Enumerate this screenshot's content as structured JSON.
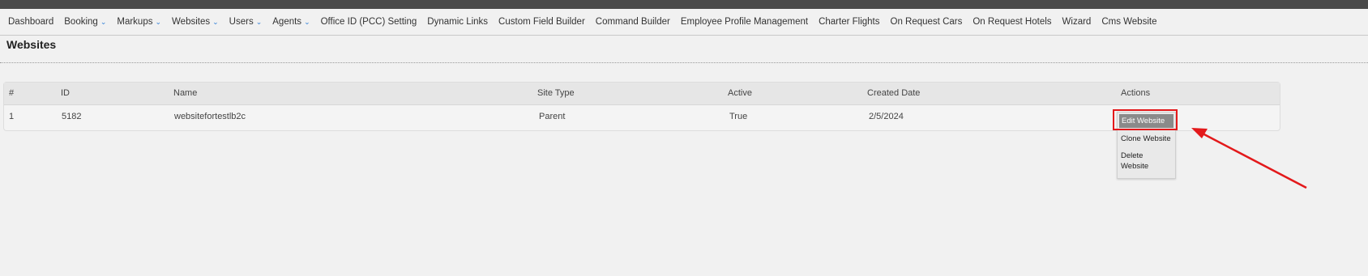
{
  "nav": {
    "items": [
      {
        "label": "Dashboard",
        "dropdown": false
      },
      {
        "label": "Booking",
        "dropdown": true
      },
      {
        "label": "Markups",
        "dropdown": true
      },
      {
        "label": "Websites",
        "dropdown": true
      },
      {
        "label": "Users",
        "dropdown": true
      },
      {
        "label": "Agents",
        "dropdown": true
      },
      {
        "label": "Office ID (PCC) Setting",
        "dropdown": false
      },
      {
        "label": "Dynamic Links",
        "dropdown": false
      },
      {
        "label": "Custom Field Builder",
        "dropdown": false
      },
      {
        "label": "Command Builder",
        "dropdown": false
      },
      {
        "label": "Employee Profile Management",
        "dropdown": false
      },
      {
        "label": "Charter Flights",
        "dropdown": false
      },
      {
        "label": "On Request Cars",
        "dropdown": false
      },
      {
        "label": "On Request Hotels",
        "dropdown": false
      },
      {
        "label": "Wizard",
        "dropdown": false
      },
      {
        "label": "Cms Website",
        "dropdown": false
      }
    ]
  },
  "page": {
    "title": "Websites"
  },
  "table": {
    "headers": [
      "#",
      "ID",
      "Name",
      "Site Type",
      "Active",
      "Created Date",
      "Actions"
    ],
    "rows": [
      [
        "1",
        "5182",
        "websitefortestlb2c",
        "Parent",
        "True",
        "2/5/2024"
      ]
    ]
  },
  "actions_menu": {
    "edit": "Edit Website",
    "clone": "Clone Website",
    "delete": "Delete Website"
  },
  "colors": {
    "annotation": "#e3191b",
    "accent": "#2f7fd8"
  }
}
